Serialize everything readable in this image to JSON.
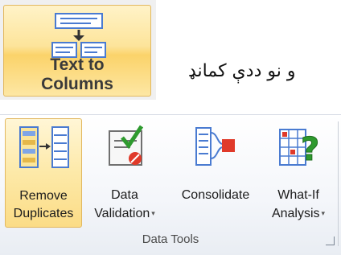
{
  "top_button": {
    "label_line1": "Text to",
    "label_line2": "Columns",
    "icon": "text-to-columns-icon"
  },
  "caption": "و نو ددې كمانډ",
  "ribbon": {
    "group_label": "Data Tools",
    "buttons": [
      {
        "line1": "Remove",
        "line2": "Duplicates",
        "icon": "remove-duplicates-icon"
      },
      {
        "line1": "Data",
        "line2": "Validation",
        "icon": "data-validation-icon",
        "dropdown": "▾"
      },
      {
        "line1": "Consolidate",
        "line2": "",
        "icon": "consolidate-icon"
      },
      {
        "line1": "What-If",
        "line2": "Analysis",
        "icon": "what-if-analysis-icon",
        "dropdown": "▾"
      }
    ]
  },
  "colors": {
    "hover_border": "#e2b860",
    "hover_fill": "#fde49a",
    "icon_blue": "#4a7bd1",
    "icon_green": "#2e9a2e",
    "icon_red": "#e03a2a"
  }
}
